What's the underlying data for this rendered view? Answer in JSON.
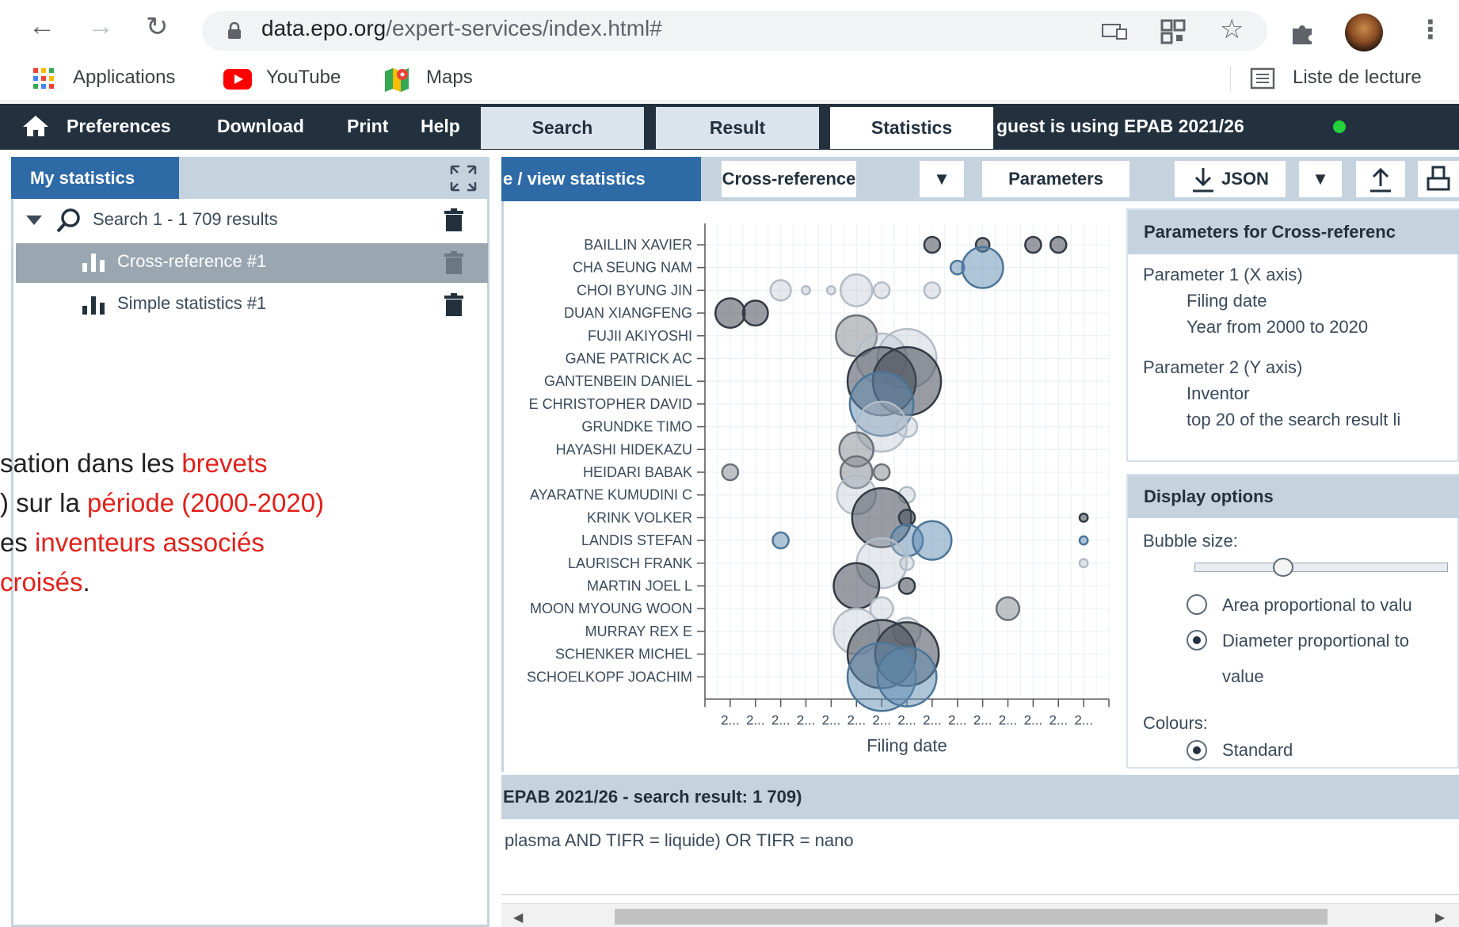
{
  "browser": {
    "url_host": "data.epo.org",
    "url_path": "/expert-services/index.html#",
    "bookmarks": [
      "Applications",
      "YouTube",
      "Maps"
    ],
    "reading_list": "Liste de lecture"
  },
  "appbar": {
    "menu": [
      "Preferences",
      "Download",
      "Print",
      "Help"
    ],
    "tabs": [
      "Search",
      "Result",
      "Statistics"
    ],
    "active_tab": "Statistics",
    "guest_text": "guest is using EPAB 2021/26",
    "status_color": "#22d13c"
  },
  "left_panel": {
    "header": "My statistics",
    "search_item": "Search 1 - 1 709 results",
    "items": [
      {
        "label": "Cross-reference #1",
        "selected": true
      },
      {
        "label": "Simple statistics #1",
        "selected": false
      }
    ]
  },
  "annotation": {
    "line1_a": "sation dans les ",
    "line1_b": "brevets",
    "line2_a": ") sur la ",
    "line2_b": "période (2000-2020)",
    "line3_a": "es ",
    "line3_b": "inventeurs associés",
    "line4_a": "croisés",
    "line4_b": "."
  },
  "toolbar": {
    "view_tab": "e / view statistics",
    "dropdown_value": "Cross-reference",
    "parameters_label": "Parameters",
    "json_label": "JSON"
  },
  "chart_data": {
    "type": "scatter",
    "xlabel": "Filing date",
    "x_tick_label": "2...",
    "x_tick_count": 15,
    "categories": [
      "BAILLIN XAVIER",
      "CHA SEUNG NAM",
      "CHOI BYUNG JIN",
      "DUAN XIANGFENG",
      "FUJII AKIYOSHI",
      "GANE PATRICK AC",
      "GANTENBEIN DANIEL",
      "E CHRISTOPHER DAVID",
      "GRUNDKE TIMO",
      "HAYASHI HIDEKAZU",
      "HEIDARI BABAK",
      "AYARATNE KUMUDINI C",
      "KRINK VOLKER",
      "LANDIS STEFAN",
      "LAURISCH FRANK",
      "MARTIN JOEL L",
      "MOON MYOUNG WOON",
      "MURRAY REX E",
      "SCHENKER MICHEL",
      "SCHOELKOPF JOACHIM"
    ],
    "bubbles": [
      {
        "row": 0,
        "col": 9,
        "r": 0.35,
        "shade": "dark"
      },
      {
        "row": 0,
        "col": 11,
        "r": 0.3,
        "shade": "dark"
      },
      {
        "row": 0,
        "col": 13,
        "r": 0.35,
        "shade": "dark"
      },
      {
        "row": 0,
        "col": 14,
        "r": 0.35,
        "shade": "dark"
      },
      {
        "row": 1,
        "col": 10,
        "r": 0.3,
        "shade": "blue"
      },
      {
        "row": 1,
        "col": 11,
        "r": 0.9,
        "shade": "blue"
      },
      {
        "row": 2,
        "col": 3,
        "r": 0.45,
        "shade": "light"
      },
      {
        "row": 2,
        "col": 4,
        "r": 0.18,
        "shade": "light"
      },
      {
        "row": 2,
        "col": 5,
        "r": 0.18,
        "shade": "light"
      },
      {
        "row": 2,
        "col": 6,
        "r": 0.7,
        "shade": "light"
      },
      {
        "row": 2,
        "col": 7,
        "r": 0.35,
        "shade": "light"
      },
      {
        "row": 2,
        "col": 9,
        "r": 0.35,
        "shade": "light"
      },
      {
        "row": 3,
        "col": 1,
        "r": 0.65,
        "shade": "dark"
      },
      {
        "row": 3,
        "col": 2,
        "r": 0.55,
        "shade": "dark"
      },
      {
        "row": 4,
        "col": 6,
        "r": 0.9,
        "shade": "mid"
      },
      {
        "row": 5,
        "col": 7,
        "r": 1.1,
        "shade": "light"
      },
      {
        "row": 5,
        "col": 8,
        "r": 1.3,
        "shade": "light"
      },
      {
        "row": 6,
        "col": 7,
        "r": 1.5,
        "shade": "dark"
      },
      {
        "row": 6,
        "col": 8,
        "r": 1.5,
        "shade": "dark"
      },
      {
        "row": 7,
        "col": 7,
        "r": 1.4,
        "shade": "blue"
      },
      {
        "row": 8,
        "col": 7,
        "r": 1.1,
        "shade": "light"
      },
      {
        "row": 8,
        "col": 8,
        "r": 0.45,
        "shade": "light"
      },
      {
        "row": 9,
        "col": 6,
        "r": 0.75,
        "shade": "mid"
      },
      {
        "row": 10,
        "col": 1,
        "r": 0.35,
        "shade": "mid"
      },
      {
        "row": 10,
        "col": 6,
        "r": 0.7,
        "shade": "mid"
      },
      {
        "row": 10,
        "col": 7,
        "r": 0.35,
        "shade": "mid"
      },
      {
        "row": 11,
        "col": 6,
        "r": 0.85,
        "shade": "light"
      },
      {
        "row": 11,
        "col": 8,
        "r": 0.35,
        "shade": "light"
      },
      {
        "row": 12,
        "col": 7,
        "r": 1.3,
        "shade": "dark"
      },
      {
        "row": 12,
        "col": 8,
        "r": 0.35,
        "shade": "dark"
      },
      {
        "row": 12,
        "col": 15,
        "r": 0.18,
        "shade": "dark"
      },
      {
        "row": 13,
        "col": 3,
        "r": 0.35,
        "shade": "blue"
      },
      {
        "row": 13,
        "col": 8,
        "r": 0.7,
        "shade": "blue"
      },
      {
        "row": 13,
        "col": 9,
        "r": 0.85,
        "shade": "blue"
      },
      {
        "row": 13,
        "col": 15,
        "r": 0.18,
        "shade": "blue"
      },
      {
        "row": 14,
        "col": 7,
        "r": 1.1,
        "shade": "light"
      },
      {
        "row": 14,
        "col": 8,
        "r": 0.3,
        "shade": "light"
      },
      {
        "row": 14,
        "col": 15,
        "r": 0.18,
        "shade": "light"
      },
      {
        "row": 15,
        "col": 6,
        "r": 1.0,
        "shade": "dark"
      },
      {
        "row": 15,
        "col": 8,
        "r": 0.35,
        "shade": "dark"
      },
      {
        "row": 16,
        "col": 7,
        "r": 0.5,
        "shade": "light"
      },
      {
        "row": 16,
        "col": 12,
        "r": 0.5,
        "shade": "mid"
      },
      {
        "row": 17,
        "col": 6,
        "r": 1.0,
        "shade": "light"
      },
      {
        "row": 17,
        "col": 8,
        "r": 0.6,
        "shade": "light"
      },
      {
        "row": 18,
        "col": 7,
        "r": 1.5,
        "shade": "dark"
      },
      {
        "row": 18,
        "col": 8,
        "r": 1.4,
        "shade": "dark"
      },
      {
        "row": 19,
        "col": 7,
        "r": 1.5,
        "shade": "blue"
      },
      {
        "row": 19,
        "col": 8,
        "r": 1.3,
        "shade": "blue"
      }
    ]
  },
  "parameters_panel": {
    "header": "Parameters for Cross-referenc",
    "p1_title": "Parameter 1 (X axis)",
    "p1_line1": "Filing date",
    "p1_line2": "Year from 2000 to 2020",
    "p2_title": "Parameter 2 (Y axis)",
    "p2_line1": "Inventor",
    "p2_line2": "top 20 of the search result li"
  },
  "display_panel": {
    "header": "Display options",
    "bubble_size": "Bubble size:",
    "bubble_size_level": 0.35,
    "radio1": "Area proportional to valu",
    "radio2_line1": "Diameter proportional to",
    "radio2_line2": "value",
    "colours_label": "Colours:",
    "colours_value": "Standard"
  },
  "bottom": {
    "header": "EPAB 2021/26 - search result: 1 709)",
    "query": "plasma AND TIFR = liquide) OR TIFR = nano"
  }
}
